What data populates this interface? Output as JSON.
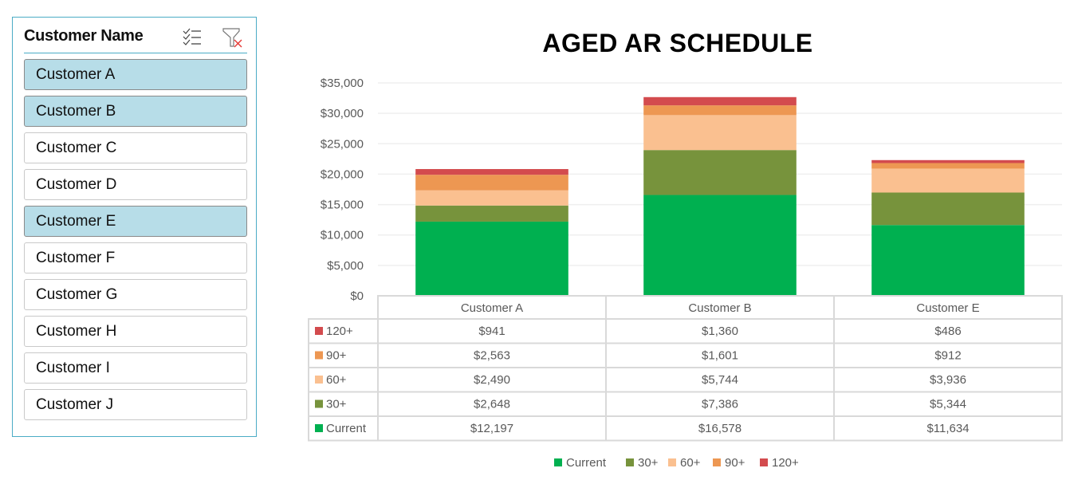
{
  "slicer": {
    "title": "Customer Name",
    "multiselect_icon": "multi-select-checklist-icon",
    "clear_filter_icon": "clear-filter-icon",
    "accent_color": "#4bacc6",
    "selected_color": "#b7dde8",
    "items": [
      {
        "label": "Customer A",
        "selected": true
      },
      {
        "label": "Customer B",
        "selected": true
      },
      {
        "label": "Customer C",
        "selected": false
      },
      {
        "label": "Customer D",
        "selected": false
      },
      {
        "label": "Customer E",
        "selected": true
      },
      {
        "label": "Customer F",
        "selected": false
      },
      {
        "label": "Customer G",
        "selected": false
      },
      {
        "label": "Customer H",
        "selected": false
      },
      {
        "label": "Customer I",
        "selected": false
      },
      {
        "label": "Customer J",
        "selected": false
      }
    ]
  },
  "chart_data": {
    "type": "bar",
    "stacked": true,
    "title": "AGED AR SCHEDULE",
    "xlabel": "",
    "ylabel": "",
    "categories": [
      "Customer A",
      "Customer B",
      "Customer E"
    ],
    "ylim": [
      0,
      35000
    ],
    "yticks": [
      0,
      5000,
      10000,
      15000,
      20000,
      25000,
      30000,
      35000
    ],
    "ytick_labels": [
      "$0",
      "$5,000",
      "$10,000",
      "$15,000",
      "$20,000",
      "$25,000",
      "$30,000",
      "$35,000"
    ],
    "grid": true,
    "legend_position": "bottom",
    "series": [
      {
        "name": "Current",
        "color": "#00b050",
        "values": [
          12197,
          16578,
          11634
        ],
        "labels": [
          "$12,197",
          "$16,578",
          "$11,634"
        ]
      },
      {
        "name": "30+",
        "color": "#77933c",
        "values": [
          2648,
          7386,
          5344
        ],
        "labels": [
          "$2,648",
          "$7,386",
          "$5,344"
        ]
      },
      {
        "name": "60+",
        "color": "#fac090",
        "values": [
          2490,
          5744,
          3936
        ],
        "labels": [
          "$2,490",
          "$5,744",
          "$3,936"
        ]
      },
      {
        "name": "90+",
        "color": "#ed9752",
        "values": [
          2563,
          1601,
          912
        ],
        "labels": [
          "$2,563",
          "$1,601",
          "$912"
        ]
      },
      {
        "name": "120+",
        "color": "#d34b4e",
        "values": [
          941,
          1360,
          486
        ],
        "labels": [
          "$941",
          "$1,360",
          "$486"
        ]
      }
    ],
    "data_table": {
      "row_order": [
        "120+",
        "90+",
        "60+",
        "30+",
        "Current"
      ]
    }
  }
}
